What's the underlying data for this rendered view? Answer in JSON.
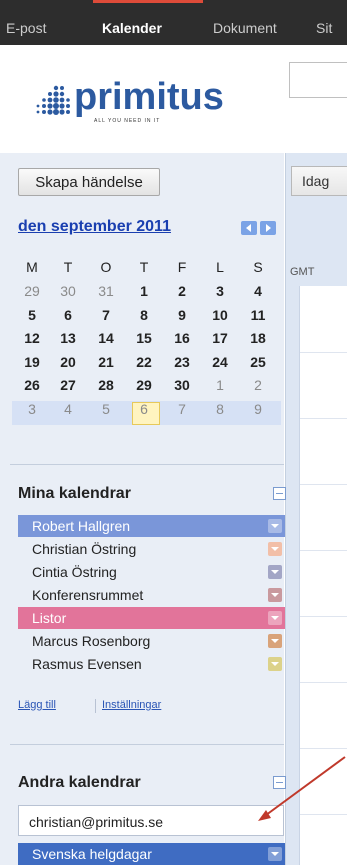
{
  "topbar": {
    "items": [
      {
        "label": "E-post"
      },
      {
        "label": "Kalender",
        "active": true
      },
      {
        "label": "Dokument"
      },
      {
        "label": "Sit"
      }
    ],
    "active_accent": "#dd4b39"
  },
  "logo": {
    "wordmark": "primitus",
    "tagline": "ALL YOU NEED IN IT"
  },
  "toolbar": {
    "create_label": "Skapa händelse",
    "today_label": "Idag"
  },
  "main": {
    "timezone_label": "GMT"
  },
  "mini_calendar": {
    "title": "den september 2011",
    "weekdays": [
      "M",
      "T",
      "O",
      "T",
      "F",
      "L",
      "S"
    ],
    "weeks": [
      [
        "29",
        "30",
        "31",
        "1",
        "2",
        "3",
        "4"
      ],
      [
        "5",
        "6",
        "7",
        "8",
        "9",
        "10",
        "11"
      ],
      [
        "12",
        "13",
        "14",
        "15",
        "16",
        "17",
        "18"
      ],
      [
        "19",
        "20",
        "21",
        "22",
        "23",
        "24",
        "25"
      ],
      [
        "26",
        "27",
        "28",
        "29",
        "30",
        "1",
        "2"
      ],
      [
        "3",
        "4",
        "5",
        "6",
        "7",
        "8",
        "9"
      ]
    ],
    "today": "29"
  },
  "my_calendars": {
    "title": "Mina kalendrar",
    "items": [
      {
        "label": "Robert Hallgren",
        "color": "#7a96d9",
        "selected": true
      },
      {
        "label": "Christian Östring",
        "color": "#f2bfa8"
      },
      {
        "label": "Cintia Östring",
        "color": "#a3a6c6"
      },
      {
        "label": "Konferensrummet",
        "color": "#c9999e"
      },
      {
        "label": "Listor",
        "color": "#e2749a",
        "selected": true
      },
      {
        "label": "Marcus Rosenborg",
        "color": "#d9a37a"
      },
      {
        "label": "Rasmus Evensen",
        "color": "#dcd28a"
      }
    ],
    "add_link": "Lägg till",
    "settings_link": "Inställningar"
  },
  "other_calendars": {
    "title": "Andra kalendrar",
    "input_value": "christian@primitus.se",
    "items": [
      {
        "label": "Svenska helgdagar",
        "color": "#3f6cc2",
        "selected": true
      }
    ]
  },
  "annotation": {
    "arrow_color": "#c0392b"
  }
}
